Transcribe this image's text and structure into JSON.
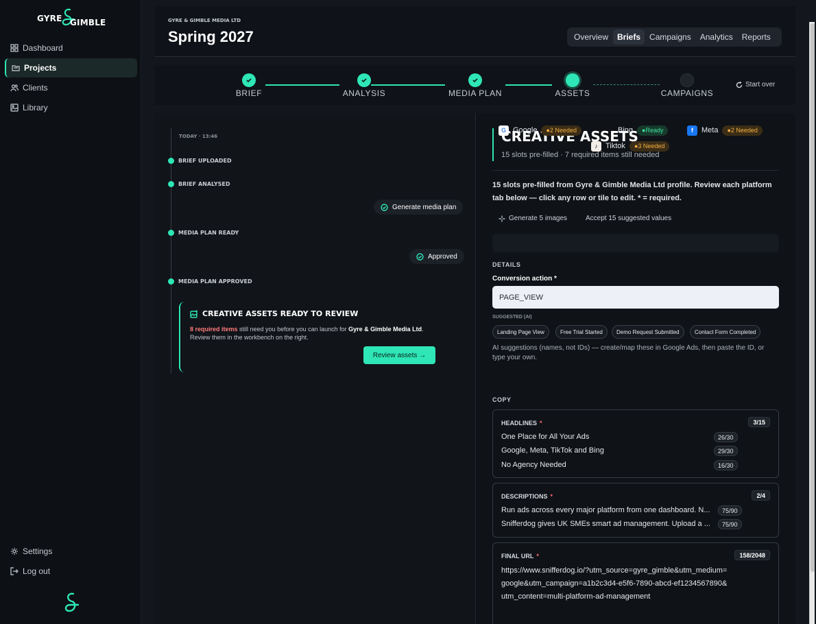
{
  "brand": {
    "name_left": "GYRE",
    "name_right": "GIMBLE",
    "accent": "#2ee6b6"
  },
  "sidebar": {
    "items": [
      {
        "label": "Dashboard",
        "icon": "grid-icon"
      },
      {
        "label": "Projects",
        "icon": "folder-icon",
        "active": true
      },
      {
        "label": "Clients",
        "icon": "users-icon"
      },
      {
        "label": "Library",
        "icon": "image-icon"
      }
    ],
    "bottom": [
      {
        "label": "Settings",
        "icon": "gear-icon"
      },
      {
        "label": "Log out",
        "icon": "logout-icon"
      }
    ]
  },
  "header": {
    "company": "GYRE & GIMBLE MEDIA LTD",
    "title": "Spring 2027",
    "tabs": [
      "Overview",
      "Briefs",
      "Campaigns",
      "Analytics",
      "Reports"
    ],
    "active_tab": "Briefs"
  },
  "stepper": {
    "steps": [
      {
        "label": "BRIEF",
        "state": "done"
      },
      {
        "label": "ANALYSIS",
        "state": "done"
      },
      {
        "label": "MEDIA PLAN",
        "state": "done"
      },
      {
        "label": "ASSETS",
        "state": "current"
      },
      {
        "label": "CAMPAIGNS",
        "state": "todo"
      }
    ],
    "start_over": "Start over"
  },
  "timeline": {
    "time": "TODAY · 13:46",
    "events": [
      "BRIEF UPLOADED",
      "BRIEF ANALYSED",
      "MEDIA PLAN READY",
      "MEDIA PLAN APPROVED"
    ],
    "chip_generate": "Generate media plan",
    "chip_approved": "Approved",
    "ready_card": {
      "title": "CREATIVE ASSETS READY TO REVIEW",
      "red": "8 required items",
      "text1": " still need you before you can launch for ",
      "bold": "Gyre & Gimble Media Ltd",
      "text2": ". Review them in the workbench on the right.",
      "button": "Review assets →"
    }
  },
  "assets": {
    "title": "CREATIVE ASSETS",
    "subtitle": "15 slots pre-filled · 7 required items still needed",
    "intro": "15 slots pre-filled from Gyre & Gimble Media Ltd profile. Review each platform tab below — click any row or tile to edit. * = required.",
    "action_generate": "Generate 5 images",
    "action_accept": "Accept 15 suggested values",
    "platforms": [
      {
        "name": "Google",
        "badge": "2 Needed",
        "status": "needed"
      },
      {
        "name": "Bing",
        "badge": "Ready",
        "status": "ready"
      },
      {
        "name": "Meta",
        "badge": "2 Needed",
        "status": "needed"
      },
      {
        "name": "Tiktok",
        "badge": "3 Needed",
        "status": "needed"
      }
    ],
    "details_label": "DETAILS",
    "conversion_label": "Conversion action *",
    "conversion_value": "PAGE_VIEW",
    "suggested_label": "SUGGESTED (AI)",
    "suggestions": [
      "Landing Page View",
      "Free Trial Started",
      "Demo Request Submitted",
      "Contact Form Completed"
    ],
    "ai_note": "AI suggestions (names, not IDs) — create/map these in Google Ads, then paste the ID, or type your own.",
    "copy_label": "COPY",
    "headlines": {
      "label": "HEADLINES",
      "count": "3/15",
      "rows": [
        {
          "text": "One Place for All Your Ads",
          "count": "26/30"
        },
        {
          "text": "Google, Meta, TikTok and Bing",
          "count": "29/30"
        },
        {
          "text": "No Agency Needed",
          "count": "16/30"
        }
      ]
    },
    "descriptions": {
      "label": "DESCRIPTIONS",
      "count": "2/4",
      "rows": [
        {
          "text": "Run ads across every major platform from one dashboard. N...",
          "count": "75/90"
        },
        {
          "text": "Snifferdog gives UK SMEs smart ad management. Upload a ...",
          "count": "75/90"
        }
      ]
    },
    "final_url": {
      "label": "FINAL URL",
      "count": "158/2048",
      "value": "https://www.snifferdog.io/?utm_source=gyre_gimble&utm_medium=google&utm_campaign=a1b2c3d4-e5f6-7890-abcd-ef1234567890&utm_content=multi-platform-ad-management"
    }
  }
}
